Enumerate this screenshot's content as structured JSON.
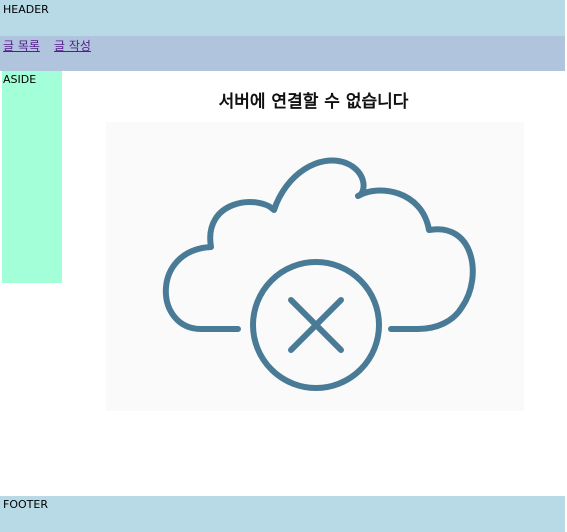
{
  "header": {
    "label": "HEADER"
  },
  "nav": {
    "links": [
      {
        "label": "글 목록"
      },
      {
        "label": "글 작성"
      }
    ]
  },
  "aside": {
    "label": "ASIDE"
  },
  "main": {
    "title": "서버에 연결할 수 없습니다",
    "image": {
      "icon": "cloud-x-icon",
      "color": "#4a7b96"
    }
  },
  "footer": {
    "label": "FOOTER"
  },
  "colors": {
    "header_bg": "#b7dae6",
    "nav_bg": "#b0c4de",
    "aside_bg": "#a2ffd8",
    "footer_bg": "#b7dae6",
    "link": "#551a8b"
  }
}
